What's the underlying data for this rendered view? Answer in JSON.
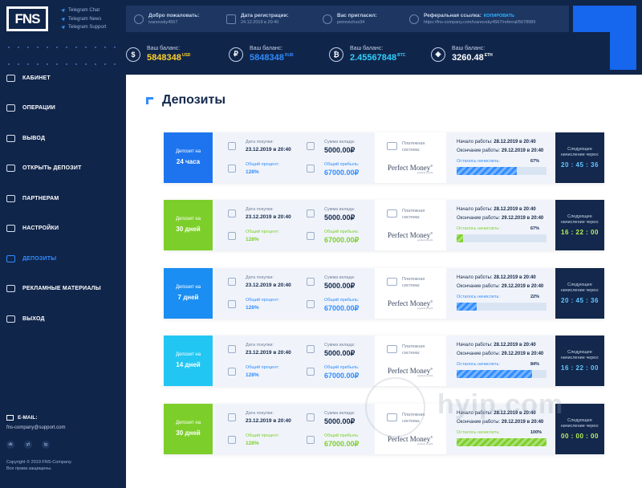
{
  "brand": {
    "logo": "FNS"
  },
  "telegram": [
    "Telegram Chat",
    "Telegram News",
    "Telegram Support"
  ],
  "userinfo": {
    "welcome_label": "Добро пожаловать:",
    "welcome_value": "ivanovsky4567",
    "reg_label": "Дата регистрации:",
    "reg_value": "24.12.2019 в 20:40",
    "invited_label": "Вас пригласил:",
    "invited_value": "petrovichus34",
    "ref_label": "Реферальная ссылка:",
    "ref_copy": "КОПИРОВАТЬ",
    "ref_value": "https://fns-company.com/ivanovsky4567/referral/5678989"
  },
  "balances": [
    {
      "label": "Ваш баланс:",
      "value": "5848348",
      "unit": "USD",
      "symbol": "$",
      "color": "#ffd12b"
    },
    {
      "label": "Ваш баланс:",
      "value": "5848348",
      "unit": "RUB",
      "symbol": "₽",
      "color": "#2f8cff"
    },
    {
      "label": "Ваш баланс:",
      "value": "2.45567848",
      "unit": "BTC",
      "symbol": "₿",
      "color": "#2fd0ff"
    },
    {
      "label": "Ваш баланс:",
      "value": "3260.48",
      "unit": "ETH",
      "symbol": "◈",
      "color": "#ffffff"
    }
  ],
  "nav": [
    {
      "label": "КАБИНЕТ",
      "active": false
    },
    {
      "label": "ОПЕРАЦИИ",
      "active": false
    },
    {
      "label": "ВЫВОД",
      "active": false
    },
    {
      "label": "ОТКРЫТЬ ДЕПОЗИТ",
      "active": false
    },
    {
      "label": "ПАРТНЕРАМ",
      "active": false
    },
    {
      "label": "НАСТРОЙКИ",
      "active": false
    },
    {
      "label": "ДЕПОЗИТЫ",
      "active": true
    },
    {
      "label": "РЕКЛАМНЫЕ МАТЕРИАЛЫ",
      "active": false
    },
    {
      "label": "ВЫХОД",
      "active": false
    }
  ],
  "contacts": {
    "email_label": "E-MAIL:",
    "email": "fns-company@support.com",
    "social": [
      "vk",
      "yt",
      "ig"
    ],
    "copyright_1": "Copyright © 2019 FNS-Company.",
    "copyright_2": "Все права защищены."
  },
  "page": {
    "title": "Депозиты"
  },
  "labels": {
    "buy_date": "Дата покупки:",
    "deposit_sum": "Сумма вклада:",
    "total_percent": "Общий процент:",
    "total_profit": "Общий прибыль:",
    "payment_system": "Платежная система:",
    "start": "Начало работы:",
    "end": "Окончание работы:",
    "remaining": "Осталось начислить:",
    "next_accrual": "Следующее начисление через:",
    "pm": "Perfect Money",
    "pm_sub": "payment system"
  },
  "deposits": [
    {
      "type_label": "Депозит на",
      "duration": "24 часа",
      "color": "#1e74ee",
      "buy_date": "23.12.2019 в 20:40",
      "sum": "5000.00₽",
      "percent": "128%",
      "profit": "67000.00₽",
      "start": "28.12.2019 в 20:40",
      "end": "29.12.2019 в 20:40",
      "progress": 67,
      "progress_label": "67%",
      "timer": "20 : 45 : 36"
    },
    {
      "type_label": "Депозит на",
      "duration": "30 дней",
      "color": "#7ccf2a",
      "buy_date": "23.12.2019 в 20:40",
      "sum": "5000.00₽",
      "percent": "128%",
      "profit": "67000.00₽",
      "start": "28.12.2019 в 20:40",
      "end": "29.12.2019 в 20:40",
      "progress": 7,
      "progress_label": "67%",
      "timer": "16 : 22 : 00"
    },
    {
      "type_label": "Депозит на",
      "duration": "7 дней",
      "color": "#1a8ef2",
      "buy_date": "23.12.2019 в 20:40",
      "sum": "5000.00₽",
      "percent": "128%",
      "profit": "67000.00₽",
      "start": "28.12.2019 в 20:40",
      "end": "29.12.2019 в 20:40",
      "progress": 22,
      "progress_label": "22%",
      "timer": "20 : 45 : 36"
    },
    {
      "type_label": "Депозит на",
      "duration": "14 дней",
      "color": "#22c6f2",
      "buy_date": "23.12.2019 в 20:40",
      "sum": "5000.00₽",
      "percent": "128%",
      "profit": "67000.00₽",
      "start": "28.12.2019 в 20:40",
      "end": "29.12.2019 в 20:40",
      "progress": 84,
      "progress_label": "84%",
      "timer": "16 : 22 : 00"
    },
    {
      "type_label": "Депозит на",
      "duration": "30 дней",
      "color": "#7ccf2a",
      "buy_date": "23.12.2019 в 20:40",
      "sum": "5000.00₽",
      "percent": "128%",
      "profit": "67000.00₽",
      "start": "28.12.2019 в 20:40",
      "end": "29.12.2019 в 20:40",
      "progress": 100,
      "progress_label": "100%",
      "timer": "00 : 00 : 00"
    }
  ],
  "watermark": "hyip.com"
}
